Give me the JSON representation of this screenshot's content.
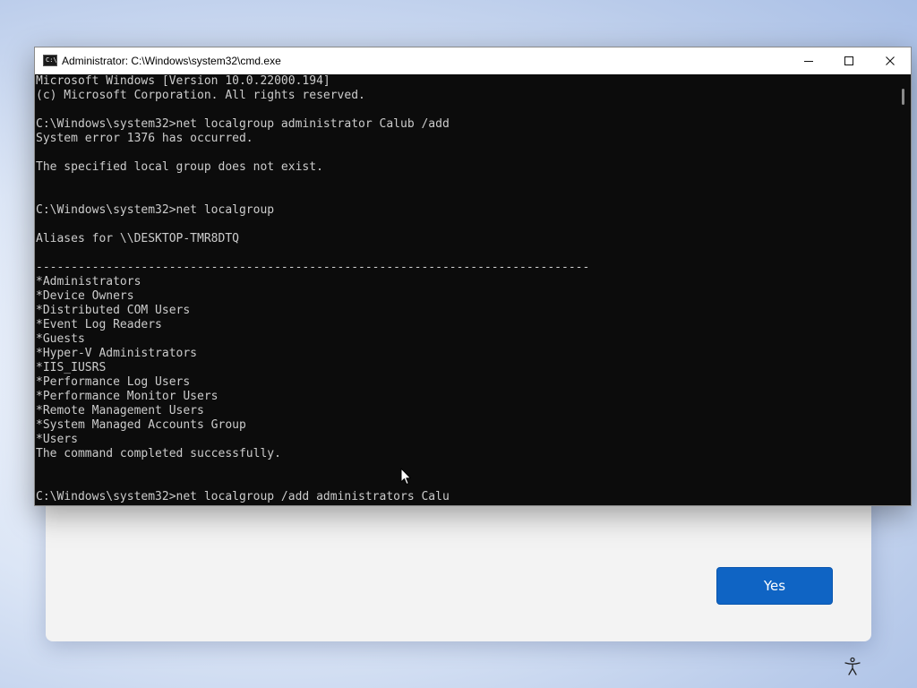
{
  "window": {
    "title": "Administrator: C:\\Windows\\system32\\cmd.exe",
    "icon_glyph": "C:\\"
  },
  "console": {
    "lines": [
      "Microsoft Windows [Version 10.0.22000.194]",
      "(c) Microsoft Corporation. All rights reserved.",
      "",
      "C:\\Windows\\system32>net localgroup administrator Calub /add",
      "System error 1376 has occurred.",
      "",
      "The specified local group does not exist.",
      "",
      "",
      "C:\\Windows\\system32>net localgroup",
      "",
      "Aliases for \\\\DESKTOP-TMR8DTQ",
      "",
      "-------------------------------------------------------------------------------",
      "*Administrators",
      "*Device Owners",
      "*Distributed COM Users",
      "*Event Log Readers",
      "*Guests",
      "*Hyper-V Administrators",
      "*IIS_IUSRS",
      "*Performance Log Users",
      "*Performance Monitor Users",
      "*Remote Management Users",
      "*System Managed Accounts Group",
      "*Users",
      "The command completed successfully.",
      "",
      "",
      "C:\\Windows\\system32>net localgroup /add administrators Calu"
    ]
  },
  "dialog": {
    "yes_label": "Yes"
  },
  "colors": {
    "console_bg": "#0c0c0c",
    "console_text": "#cccccc",
    "accent": "#0f64c4"
  },
  "icons": {
    "window": "cmd-icon",
    "minimize": "minimize-icon",
    "maximize": "maximize-icon",
    "close": "close-icon",
    "accessibility": "accessibility-icon",
    "pointer": "mouse-pointer-icon"
  }
}
